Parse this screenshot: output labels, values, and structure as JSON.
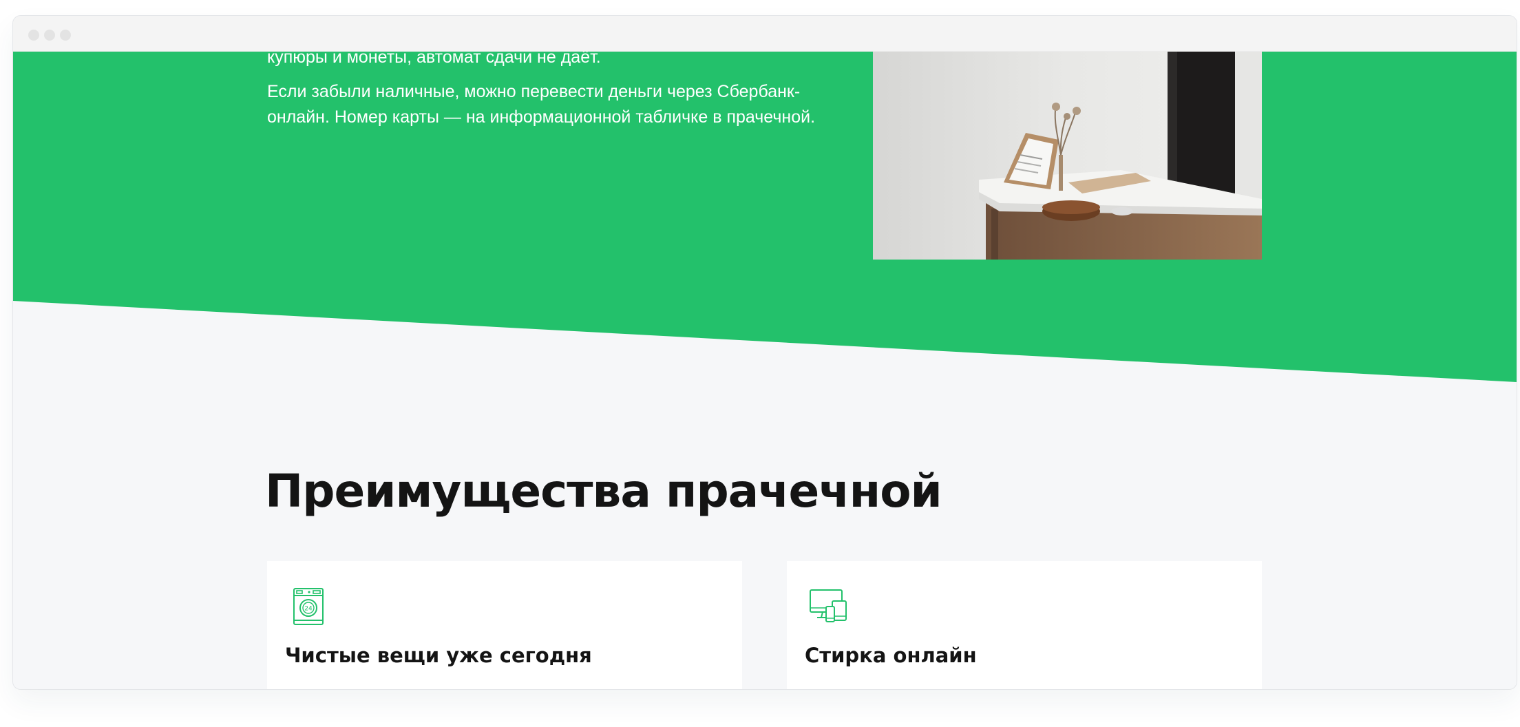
{
  "window": {
    "controls": [
      "close",
      "minimize",
      "maximize"
    ]
  },
  "payment": {
    "paragraph_1": "купюры и монеты, автомат сдачи не даёт.",
    "paragraph_2": "Если забыли наличные, можно перевести деньги через Сбербанк-онлайн. Номер карты — на информационной табличке в прачечной."
  },
  "photo": {
    "icon": "laundry-counter-photo"
  },
  "advantages": {
    "title": "Преимущества прачечной",
    "cards": [
      {
        "icon": "washing-machine-24-icon",
        "title": "Чистые вещи уже сегодня"
      },
      {
        "icon": "devices-icon",
        "title": "Стирка онлайн"
      }
    ]
  },
  "colors": {
    "accent": "#23c16b",
    "page_background": "#f6f7f9",
    "card_background": "#ffffff",
    "heading_text": "#141414"
  }
}
